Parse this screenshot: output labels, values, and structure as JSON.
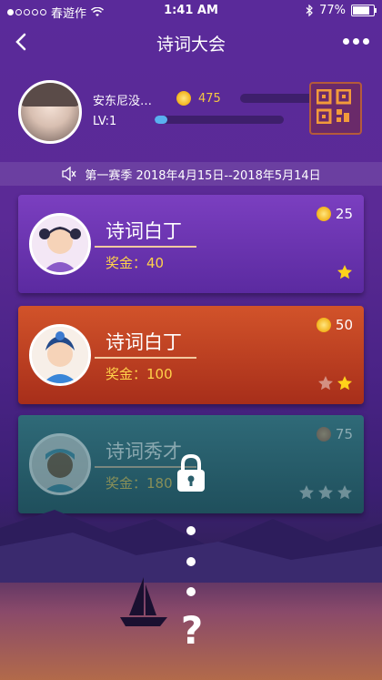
{
  "status": {
    "carrier": "春遊作",
    "time": "1:41 AM",
    "battery": "77%"
  },
  "nav": {
    "title": "诗词大会"
  },
  "profile": {
    "nickname": "安东尼没…",
    "level": "LV:1",
    "coins": "475",
    "xp_progress": 0.1
  },
  "season": {
    "text": "第一赛季 2018年4月15日--2018年5月14日"
  },
  "cards": [
    {
      "title": "诗词白丁",
      "prize": "奖金：40",
      "cost": "25",
      "stars_filled": 1,
      "stars_total": 1,
      "locked": false,
      "color": "#6b33b0"
    },
    {
      "title": "诗词白丁",
      "prize": "奖金：100",
      "cost": "50",
      "stars_filled": 1,
      "stars_total": 2,
      "locked": false,
      "color": "#c0411f"
    },
    {
      "title": "诗词秀才",
      "prize": "奖金：180",
      "cost": "75",
      "stars_filled": 0,
      "stars_total": 3,
      "locked": true,
      "color": "#2a5f6c"
    }
  ],
  "path_marker": "?"
}
